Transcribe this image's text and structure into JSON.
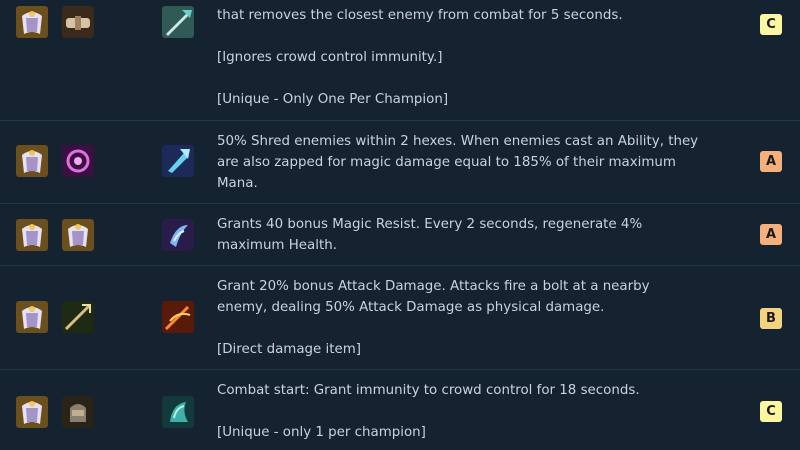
{
  "tier_colors": {
    "A": "#f4b07c",
    "B": "#f5d27e",
    "C": "#fbf7a0"
  },
  "rows": [
    {
      "components": [
        "cloak-icon",
        "belt-icon"
      ],
      "result": "quicksilver-blade-icon",
      "lines": [
        "that removes the closest enemy from combat for 5 seconds.",
        "",
        "[Ignores crowd control immunity.]",
        "",
        "[Unique - Only One Per Champion]"
      ],
      "tier": "C"
    },
    {
      "components": [
        "cloak-icon",
        "spellbook-icon"
      ],
      "result": "ionic-spark-icon",
      "lines": [
        "50% Shred enemies within 2 hexes. When enemies cast an Ability, they",
        "are also zapped for magic damage equal to 185% of their maximum",
        "Mana."
      ],
      "tier": "A"
    },
    {
      "components": [
        "cloak-icon",
        "cloak-icon"
      ],
      "result": "dragons-claw-icon",
      "lines": [
        "Grants 40 bonus Magic Resist. Every 2 seconds, regenerate 4%",
        "maximum Health."
      ],
      "tier": "A"
    },
    {
      "components": [
        "cloak-icon",
        "bow-icon"
      ],
      "result": "runaans-hurricane-icon",
      "lines": [
        "Grant 20% bonus Attack Damage. Attacks fire a bolt at a nearby",
        "enemy, dealing 50% Attack Damage as physical damage.",
        "",
        "[Direct damage item]"
      ],
      "tier": "B"
    },
    {
      "components": [
        "cloak-icon",
        "gauntlet-icon"
      ],
      "result": "quicksilver-icon",
      "lines": [
        "Combat start: Grant immunity to crowd control for 18 seconds.",
        "",
        "[Unique - only 1 per champion]"
      ],
      "tier": "C"
    }
  ]
}
